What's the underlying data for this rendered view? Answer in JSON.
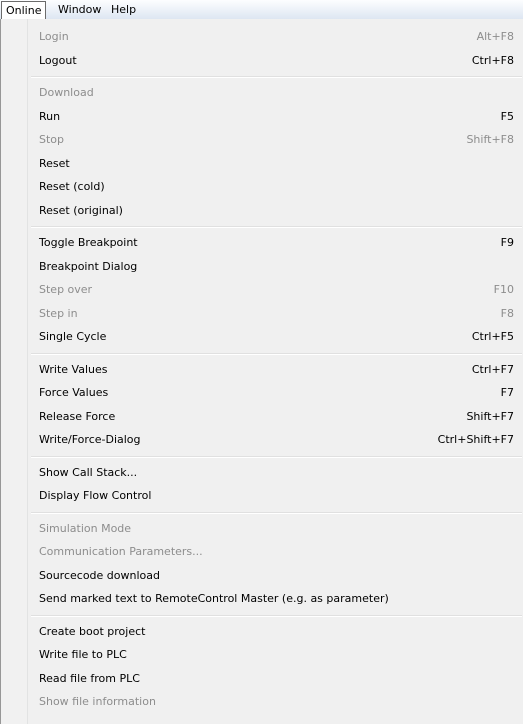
{
  "menubar": {
    "items": [
      "Online",
      "Window",
      "Help"
    ]
  },
  "menu": {
    "groups": [
      [
        {
          "label": "Login",
          "shortcut": "Alt+F8",
          "enabled": false
        },
        {
          "label": "Logout",
          "shortcut": "Ctrl+F8",
          "enabled": true
        }
      ],
      [
        {
          "label": "Download",
          "shortcut": "",
          "enabled": false
        },
        {
          "label": "Run",
          "shortcut": "F5",
          "enabled": true
        },
        {
          "label": "Stop",
          "shortcut": "Shift+F8",
          "enabled": false
        },
        {
          "label": "Reset",
          "shortcut": "",
          "enabled": true
        },
        {
          "label": "Reset (cold)",
          "shortcut": "",
          "enabled": true
        },
        {
          "label": "Reset (original)",
          "shortcut": "",
          "enabled": true
        }
      ],
      [
        {
          "label": "Toggle Breakpoint",
          "shortcut": "F9",
          "enabled": true
        },
        {
          "label": "Breakpoint Dialog",
          "shortcut": "",
          "enabled": true
        },
        {
          "label": "Step over",
          "shortcut": "F10",
          "enabled": false
        },
        {
          "label": "Step in",
          "shortcut": "F8",
          "enabled": false
        },
        {
          "label": "Single Cycle",
          "shortcut": "Ctrl+F5",
          "enabled": true
        }
      ],
      [
        {
          "label": "Write Values",
          "shortcut": "Ctrl+F7",
          "enabled": true
        },
        {
          "label": "Force Values",
          "shortcut": "F7",
          "enabled": true
        },
        {
          "label": "Release Force",
          "shortcut": "Shift+F7",
          "enabled": true
        },
        {
          "label": "Write/Force-Dialog",
          "shortcut": "Ctrl+Shift+F7",
          "enabled": true
        }
      ],
      [
        {
          "label": "Show Call Stack...",
          "shortcut": "",
          "enabled": true
        },
        {
          "label": "Display Flow Control",
          "shortcut": "",
          "enabled": true
        }
      ],
      [
        {
          "label": "Simulation Mode",
          "shortcut": "",
          "enabled": false
        },
        {
          "label": "Communication Parameters...",
          "shortcut": "",
          "enabled": false
        },
        {
          "label": "Sourcecode download",
          "shortcut": "",
          "enabled": true
        },
        {
          "label": "Send marked text to RemoteControl Master (e.g. as parameter)",
          "shortcut": "",
          "enabled": true
        }
      ],
      [
        {
          "label": "Create boot project",
          "shortcut": "",
          "enabled": true
        },
        {
          "label": "Write file to PLC",
          "shortcut": "",
          "enabled": true
        },
        {
          "label": "Read file from PLC",
          "shortcut": "",
          "enabled": true
        },
        {
          "label": "Show file information",
          "shortcut": "",
          "enabled": false
        }
      ]
    ]
  }
}
